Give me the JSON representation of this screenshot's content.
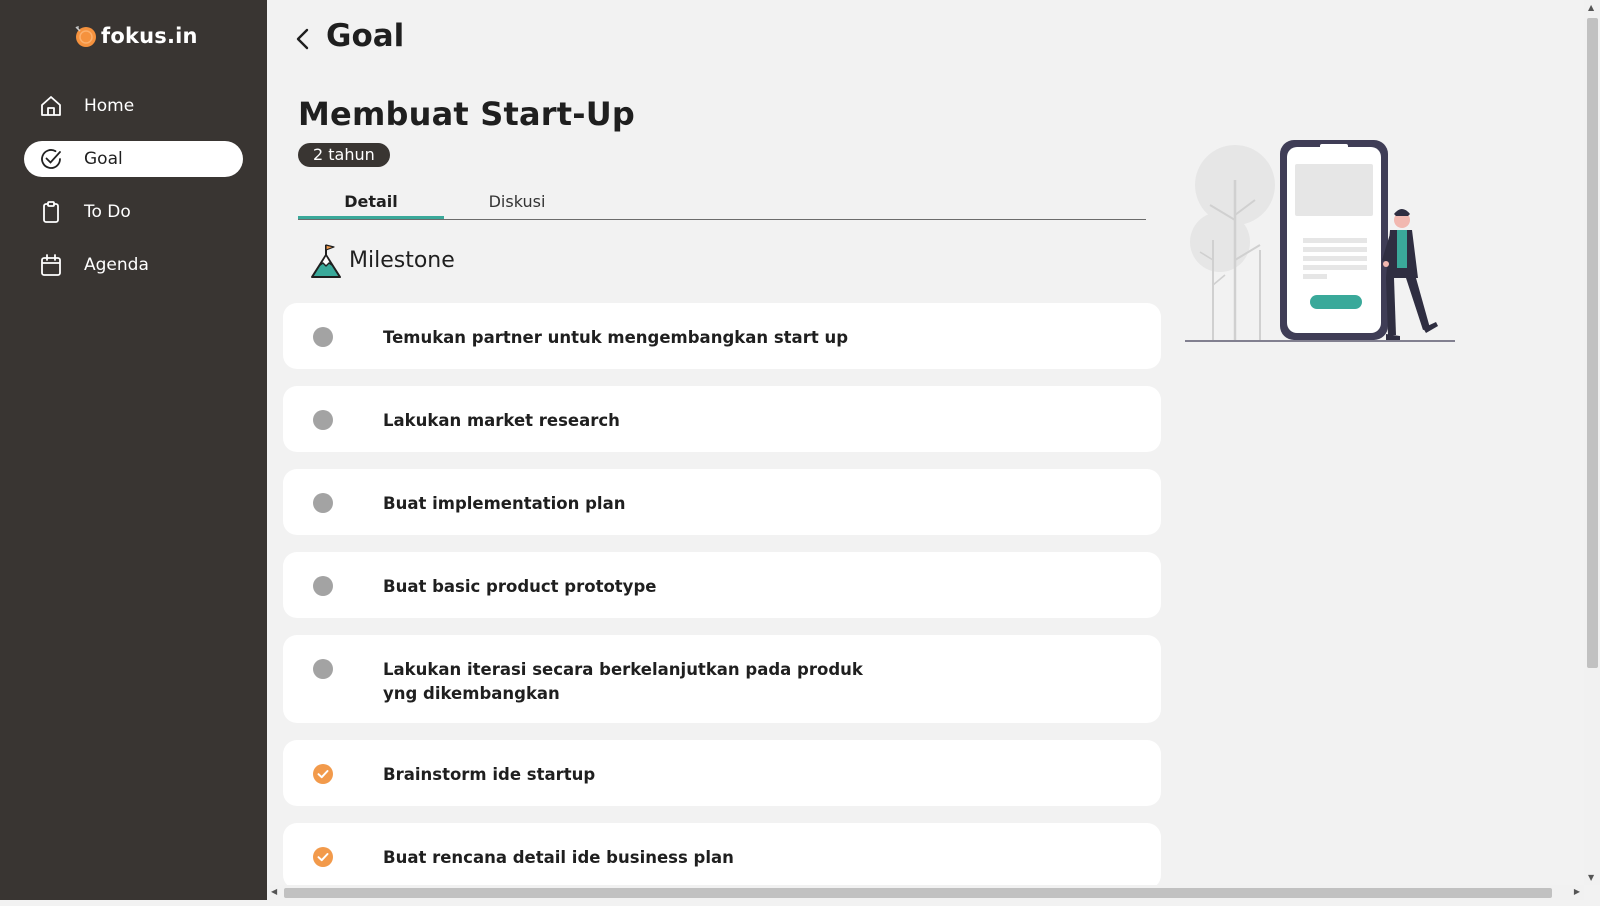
{
  "app": {
    "logo_text": "fokus.in"
  },
  "sidebar": {
    "items": [
      {
        "label": "Home",
        "icon": "home-icon"
      },
      {
        "label": "Goal",
        "icon": "check-circle-icon",
        "active": true
      },
      {
        "label": "To Do",
        "icon": "clipboard-icon"
      },
      {
        "label": "Agenda",
        "icon": "calendar-icon"
      }
    ]
  },
  "header": {
    "title": "Goal"
  },
  "goal": {
    "title": "Membuat Start-Up",
    "duration": "2 tahun"
  },
  "tabs": [
    {
      "label": "Detail",
      "active": true
    },
    {
      "label": "Diskusi",
      "active": false
    }
  ],
  "milestone": {
    "heading": "Milestone",
    "items": [
      {
        "text": "Temukan partner untuk mengembangkan start up",
        "done": false
      },
      {
        "text": "Lakukan market research",
        "done": false
      },
      {
        "text": "Buat implementation plan",
        "done": false
      },
      {
        "text": "Buat basic product prototype",
        "done": false
      },
      {
        "text": "Lakukan iterasi secara berkelanjutkan pada produk yng dikembangkan",
        "done": false
      },
      {
        "text": "Brainstorm ide startup",
        "done": true
      },
      {
        "text": "Buat rencana detail ide business plan",
        "done": true
      }
    ]
  },
  "colors": {
    "sidebar_bg": "#393532",
    "accent_teal": "#3aa99a",
    "done_orange": "#f29a4b",
    "pending_gray": "#a3a3a3",
    "logo_orange": "#f5923e"
  }
}
